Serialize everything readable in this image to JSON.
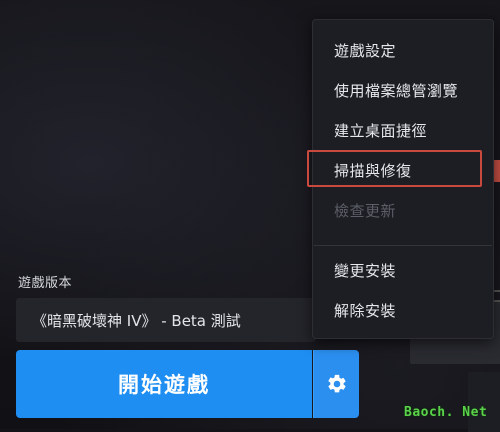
{
  "game_version": {
    "label": "遊戲版本",
    "selected": "《暗黑破壞神 IV》 - Beta 測試"
  },
  "play_button_label": "開始遊戲",
  "settings_menu": {
    "items": [
      {
        "label": "遊戲設定",
        "enabled": true
      },
      {
        "label": "使用檔案總管瀏覽",
        "enabled": true
      },
      {
        "label": "建立桌面捷徑",
        "enabled": true
      },
      {
        "label": "掃描與修復",
        "enabled": true,
        "highlighted": true
      },
      {
        "label": "檢查更新",
        "enabled": false
      },
      {
        "label": "變更安裝",
        "enabled": true
      },
      {
        "label": "解除安裝",
        "enabled": true
      }
    ]
  },
  "watermark": "Baoch. Net",
  "colors": {
    "play_button": "#1e8ef2",
    "highlight_box": "#c9493f",
    "menu_background": "#1d1e23"
  },
  "icons": {
    "settings": "gear-icon"
  }
}
